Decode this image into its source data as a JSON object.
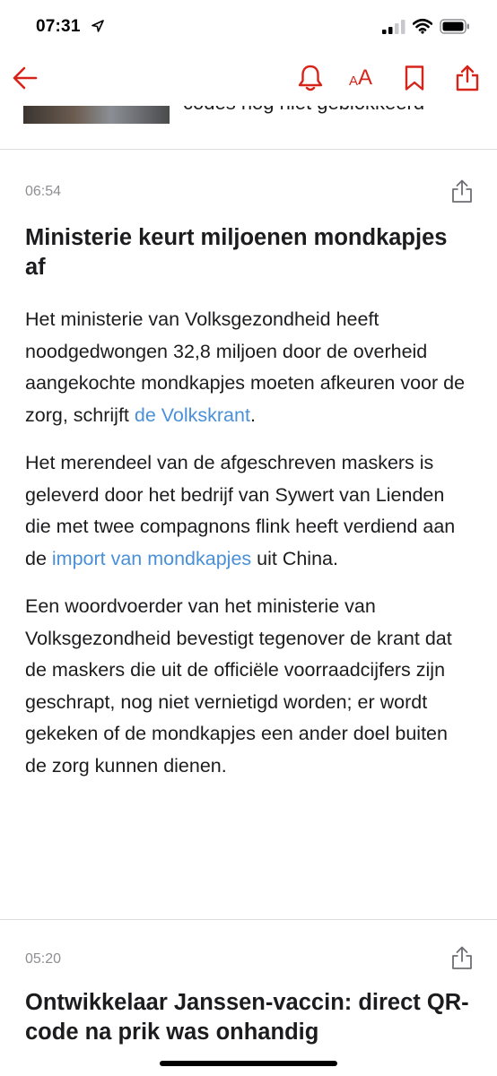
{
  "status_bar": {
    "time": "07:31"
  },
  "toolbar": {
    "back_icon": "arrow-left-icon",
    "icons": [
      "bell-icon",
      "font-size-icon",
      "bookmark-icon",
      "share-icon"
    ],
    "font_small": "A",
    "font_large": "A",
    "accent_color": "#d7241b"
  },
  "prev_item": {
    "title_partial": "codes nog niet geblokkeerd"
  },
  "articles": [
    {
      "time": "06:54",
      "title": "Ministerie keurt miljoenen mondkapjes af",
      "p1_text": "Het ministerie van Volksgezondheid heeft noodgedwongen 32,8 miljoen door de overheid aangekochte mondkapjes moeten afkeuren voor de zorg, schrijft ",
      "p1_link": "de Volkskrant",
      "p1_after": ".",
      "p2_text": "Het merendeel van de afgeschreven maskers is geleverd door het bedrijf van Sywert van Lienden die met twee compagnons flink heeft verdiend aan de ",
      "p2_link": "import van mondkapjes",
      "p2_after": " uit China.",
      "p3_text": "Een woordvoerder van het ministerie van Volksgezondheid bevestigt tegenover de krant dat de maskers die uit de officiële voorraadcijfers zijn geschrapt, nog niet vernietigd worden; er wordt gekeken of de mondkapjes een ander doel buiten de zorg kunnen dienen."
    },
    {
      "time": "05:20",
      "title": "Ontwikkelaar Janssen-vaccin: direct QR-code na prik was onhandig"
    }
  ],
  "colors": {
    "link": "#4a90d9",
    "timestamp": "#8e8e93",
    "text": "#1c1c1e"
  }
}
